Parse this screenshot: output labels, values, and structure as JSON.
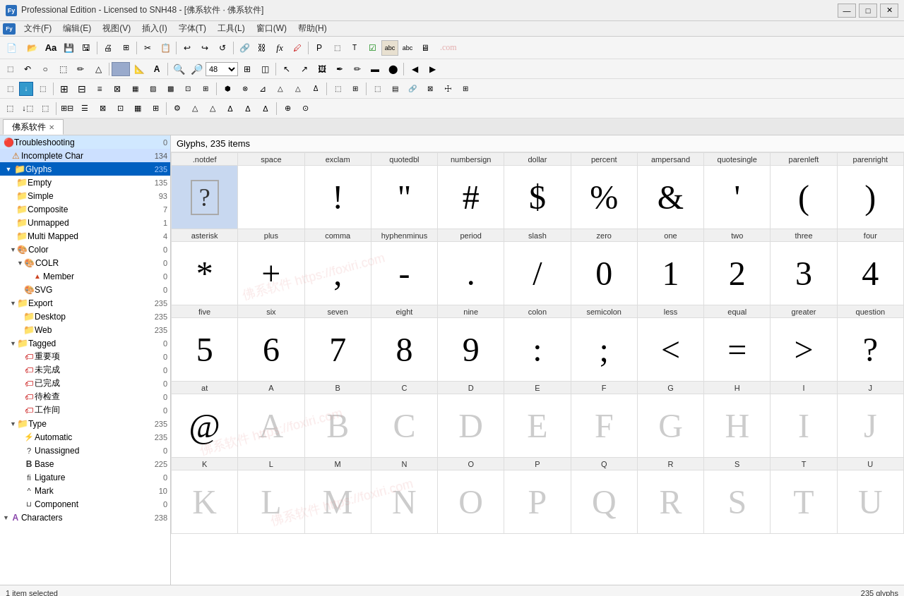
{
  "titleBar": {
    "title": "Professional Edition - Licensed to SNH48 - [佛系软件 · 佛系软件]",
    "icon": "Fy",
    "controls": {
      "minimize": "—",
      "maximize": "□",
      "close": "✕"
    }
  },
  "menuBar": {
    "items": [
      {
        "label": "文件(F)"
      },
      {
        "label": "编辑(E)"
      },
      {
        "label": "视图(V)"
      },
      {
        "label": "插入(I)"
      },
      {
        "label": "字体(T)"
      },
      {
        "label": "工具(L)"
      },
      {
        "label": "窗口(W)"
      },
      {
        "label": "帮助(H)"
      }
    ]
  },
  "tabs": [
    {
      "label": "佛系软件",
      "active": true
    }
  ],
  "sidebar": {
    "items": [
      {
        "id": "troubleshooting",
        "label": "Troubleshooting",
        "count": 0,
        "indent": 0,
        "type": "error",
        "expanded": true
      },
      {
        "id": "incomplete-char",
        "label": "Incomplete Char",
        "count": 134,
        "indent": 1,
        "type": "warning"
      },
      {
        "id": "glyphs",
        "label": "Glyphs",
        "count": 235,
        "indent": 0,
        "type": "folder",
        "expanded": true,
        "selected": false
      },
      {
        "id": "empty",
        "label": "Empty",
        "count": 135,
        "indent": 1,
        "type": "folder"
      },
      {
        "id": "simple",
        "label": "Simple",
        "count": 93,
        "indent": 1,
        "type": "folder"
      },
      {
        "id": "composite",
        "label": "Composite",
        "count": 7,
        "indent": 1,
        "type": "folder"
      },
      {
        "id": "unmapped",
        "label": "Unmapped",
        "count": 1,
        "indent": 1,
        "type": "folder"
      },
      {
        "id": "multi-mapped",
        "label": "Multi Mapped",
        "count": 4,
        "indent": 1,
        "type": "folder"
      },
      {
        "id": "color",
        "label": "Color",
        "count": 0,
        "indent": 1,
        "type": "folder-color",
        "expanded": true
      },
      {
        "id": "colr",
        "label": "COLR",
        "count": 0,
        "indent": 2,
        "type": "folder-color",
        "expanded": true
      },
      {
        "id": "member",
        "label": "Member",
        "count": 0,
        "indent": 3,
        "type": "triangle"
      },
      {
        "id": "svg",
        "label": "SVG",
        "count": 0,
        "indent": 2,
        "type": "folder-svg"
      },
      {
        "id": "export",
        "label": "Export",
        "count": 235,
        "indent": 1,
        "type": "folder",
        "expanded": true
      },
      {
        "id": "desktop",
        "label": "Desktop",
        "count": 235,
        "indent": 2,
        "type": "folder"
      },
      {
        "id": "web",
        "label": "Web",
        "count": 235,
        "indent": 2,
        "type": "folder"
      },
      {
        "id": "tagged",
        "label": "Tagged",
        "count": 0,
        "indent": 1,
        "type": "folder",
        "expanded": true
      },
      {
        "id": "tag1",
        "label": "重要项",
        "count": 0,
        "indent": 2,
        "type": "tag"
      },
      {
        "id": "tag2",
        "label": "未完成",
        "count": 0,
        "indent": 2,
        "type": "tag"
      },
      {
        "id": "tag3",
        "label": "已完成",
        "count": 0,
        "indent": 2,
        "type": "tag"
      },
      {
        "id": "tag4",
        "label": "待检查",
        "count": 0,
        "indent": 2,
        "type": "tag"
      },
      {
        "id": "tag5",
        "label": "工作间",
        "count": 0,
        "indent": 2,
        "type": "tag"
      },
      {
        "id": "type",
        "label": "Type",
        "count": 235,
        "indent": 1,
        "type": "folder",
        "expanded": true
      },
      {
        "id": "automatic",
        "label": "Automatic",
        "count": 235,
        "indent": 2,
        "type": "auto"
      },
      {
        "id": "unassigned",
        "label": "Unassigned",
        "count": 0,
        "indent": 2,
        "type": "question"
      },
      {
        "id": "base",
        "label": "Base",
        "count": 225,
        "indent": 2,
        "type": "base"
      },
      {
        "id": "ligature",
        "label": "Ligature",
        "count": 0,
        "indent": 2,
        "type": "ligature"
      },
      {
        "id": "mark",
        "label": "Mark",
        "count": 10,
        "indent": 2,
        "type": "mark"
      },
      {
        "id": "component",
        "label": "Component",
        "count": 0,
        "indent": 2,
        "type": "component"
      },
      {
        "id": "characters",
        "label": "Characters",
        "count": 238,
        "indent": 0,
        "type": "char"
      }
    ]
  },
  "glyphPanel": {
    "header": "Glyphs, 235 items",
    "columns": [
      ".notdef",
      "space",
      "exclam",
      "quotedbl",
      "numbersign",
      "dollar",
      "percent",
      "ampersand",
      "quotesingle",
      "parenleft",
      "parenright"
    ],
    "rows": [
      {
        "nameRow": [
          ".notdef",
          "space",
          "exclam",
          "quotedbl",
          "numbersign",
          "dollar",
          "percent",
          "ampersand",
          "quotesingle",
          "parenleft",
          "parenright"
        ],
        "chars": [
          "?box",
          "",
          "!",
          "\"",
          "#",
          "$",
          "%",
          "&",
          "'",
          "(",
          ")"
        ]
      },
      {
        "nameRow": [
          "asterisk",
          "plus",
          "comma",
          "hyphenminus",
          "period",
          "slash",
          "zero",
          "one",
          "two",
          "three",
          "four"
        ],
        "chars": [
          "*",
          "+",
          ",",
          "-",
          ".",
          "/",
          "0",
          "1",
          "2",
          "3",
          "4"
        ]
      },
      {
        "nameRow": [
          "five",
          "six",
          "seven",
          "eight",
          "nine",
          "colon",
          "semicolon",
          "less",
          "equal",
          "greater",
          "question"
        ],
        "chars": [
          "5",
          "6",
          "7",
          "8",
          "9",
          ":",
          ";",
          "<",
          "=",
          ">",
          "?"
        ]
      },
      {
        "nameRow": [
          "at",
          "A",
          "B",
          "C",
          "D",
          "E",
          "F",
          "G",
          "H",
          "I",
          "J"
        ],
        "chars": [
          "@",
          "A",
          "B",
          "C",
          "D",
          "E",
          "F",
          "G",
          "H",
          "I",
          "J"
        ]
      },
      {
        "nameRow": [
          "K",
          "L",
          "M",
          "N",
          "O",
          "P",
          "Q",
          "R",
          "S",
          "T",
          "U"
        ],
        "chars": [
          "K",
          "L",
          "M",
          "N",
          "O",
          "P",
          "Q",
          "R",
          "S",
          "T",
          "U"
        ]
      }
    ]
  },
  "statusBar": {
    "left": "1 item selected",
    "right": "235 glyphs"
  },
  "zoom": {
    "value": "48"
  }
}
